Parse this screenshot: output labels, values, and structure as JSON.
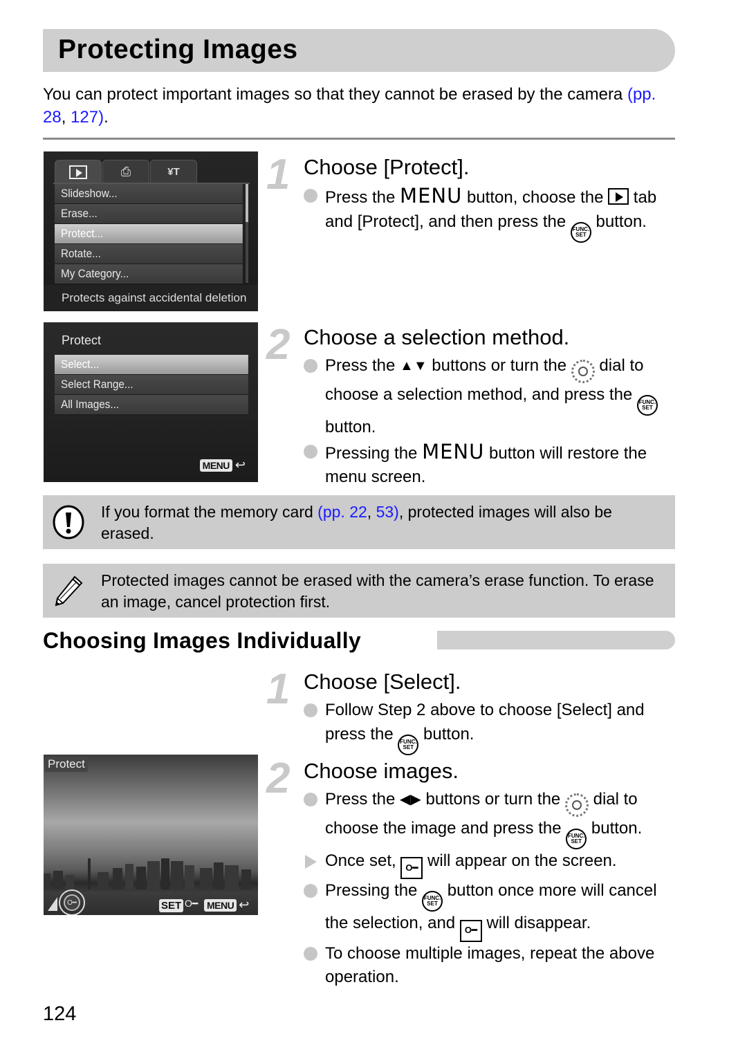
{
  "page": {
    "title": "Protecting Images",
    "intro_text": "You can protect important images so that they cannot be erased by the camera ",
    "intro_link_open": "(pp. ",
    "intro_link_1": "28",
    "intro_link_sep": ", ",
    "intro_link_2": "127",
    "intro_link_close": ")",
    "intro_end": ".",
    "page_number": "124",
    "link_color": "#1a1aff"
  },
  "screen_menu": {
    "tabs": [
      {
        "icon": "play-icon",
        "glyph": "▶"
      },
      {
        "icon": "print-icon",
        "glyph": "⎙"
      },
      {
        "icon": "tools-icon",
        "glyph": "¥T"
      }
    ],
    "items": [
      "Slideshow...",
      "Erase...",
      "Protect...",
      "Rotate...",
      "My Category..."
    ],
    "selected_index": 2,
    "hint": "Protects against accidental deletion"
  },
  "screen_protect": {
    "title": "Protect",
    "items": [
      "Select...",
      "Select Range...",
      "All Images..."
    ],
    "selected_index": 0,
    "menu_label": "MENU",
    "return_glyph": "↩"
  },
  "screen_photo": {
    "label": "Protect",
    "set_label": "SET",
    "key_glyph": "O━",
    "menu_label": "MENU",
    "return_glyph": "↩"
  },
  "step1": {
    "num": "1",
    "title": "Choose [Protect].",
    "b1_a": "Press the ",
    "b1_menu": "MENU",
    "b1_b": " button, choose the ",
    "b1_c": " tab and [Protect], and then press the ",
    "b1_d": " button."
  },
  "step2": {
    "num": "2",
    "title": "Choose a selection method.",
    "b1_a": "Press the ",
    "b1_arrows": "▲▼",
    "b1_b": " buttons or turn the ",
    "b1_c": " dial to choose a selection method, and press the ",
    "b1_d": " button.",
    "b2_a": "Pressing the ",
    "b2_menu": "MENU",
    "b2_b": " button will restore the menu screen."
  },
  "notes": {
    "caution_a": "If you format the memory card ",
    "caution_link_open": "(pp. ",
    "caution_link_1": "22",
    "caution_link_sep": ", ",
    "caution_link_2": "53",
    "caution_link_close": ")",
    "caution_b": ", protected images will also be erased.",
    "memo": "Protected images cannot be erased with the camera’s erase function. To erase an image, cancel protection first."
  },
  "section": {
    "heading": "Choosing Images Individually"
  },
  "step3": {
    "num": "1",
    "title": "Choose [Select].",
    "b1_a": "Follow Step 2 above to choose [Select] and press the ",
    "b1_b": " button."
  },
  "step4": {
    "num": "2",
    "title": "Choose images.",
    "b1_a": "Press the ",
    "b1_arrows": "◀▶",
    "b1_b": " buttons or turn the ",
    "b1_c": " dial to choose the image and press the ",
    "b1_d": " button.",
    "b2_a": "Once set, ",
    "b2_b": " will appear on the screen.",
    "b3_a": "Pressing the ",
    "b3_b": " button once more will cancel the selection, and ",
    "b3_c": " will disappear.",
    "b4": "To choose multiple images, repeat the above operation."
  },
  "icons": {
    "func_top": "FUNC.",
    "func_bottom": "SET",
    "key": "O━"
  }
}
